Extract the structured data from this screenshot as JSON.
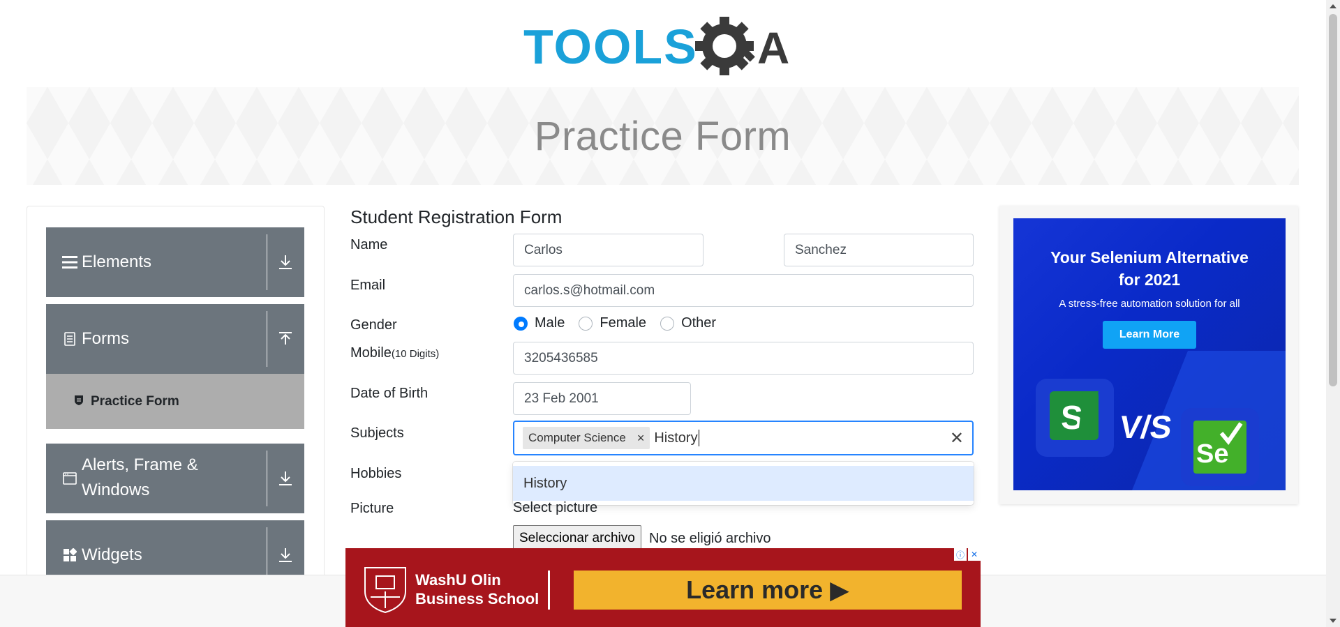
{
  "header": {
    "logo_text": "TOOLSQA"
  },
  "banner": {
    "title": "Practice Form"
  },
  "sidebar": {
    "groups": [
      {
        "label": "Elements",
        "icon": "menu-icon"
      },
      {
        "label": "Forms",
        "icon": "document-icon"
      },
      {
        "label": "Alerts, Frame &",
        "label2": "Windows",
        "icon": "window-icon"
      },
      {
        "label": "Widgets",
        "icon": "widgets-icon"
      }
    ],
    "active_item": "Practice Form"
  },
  "form": {
    "title": "Student Registration Form",
    "name_label": "Name",
    "first_name": "Carlos",
    "last_name": "Sanchez",
    "email_label": "Email",
    "email": "carlos.s@hotmail.com",
    "gender_label": "Gender",
    "genders": [
      "Male",
      "Female",
      "Other"
    ],
    "gender_selected": "Male",
    "mobile_label": "Mobile",
    "mobile_hint": "(10 Digits)",
    "mobile": "3205436585",
    "dob_label": "Date of Birth",
    "dob": "23 Feb 2001",
    "subjects_label": "Subjects",
    "subject_chip": "Computer Science",
    "subject_typed": "History",
    "subject_option": "History",
    "hobbies_label": "Hobbies",
    "picture_label": "Picture",
    "select_picture": "Select picture",
    "file_button": "Seleccionar archivo",
    "file_status": "No se eligió archivo"
  },
  "right_ad": {
    "headline_1": "Your Selenium Alternative",
    "headline_2": "for 2021",
    "sub": "A stress-free automation solution for all",
    "button": "Learn More",
    "vs": "V/S"
  },
  "bottom_ad": {
    "school_1": "WashU Olin",
    "school_2": "Business School",
    "cta": "Learn more ▶"
  },
  "colors": {
    "sidebar_group": "#6c757d",
    "active_item": "#adadad",
    "focus_border": "#2684ff",
    "option_highlight": "#deebff",
    "ad_red": "#a7151c",
    "ad_yellow": "#f2b32d"
  }
}
